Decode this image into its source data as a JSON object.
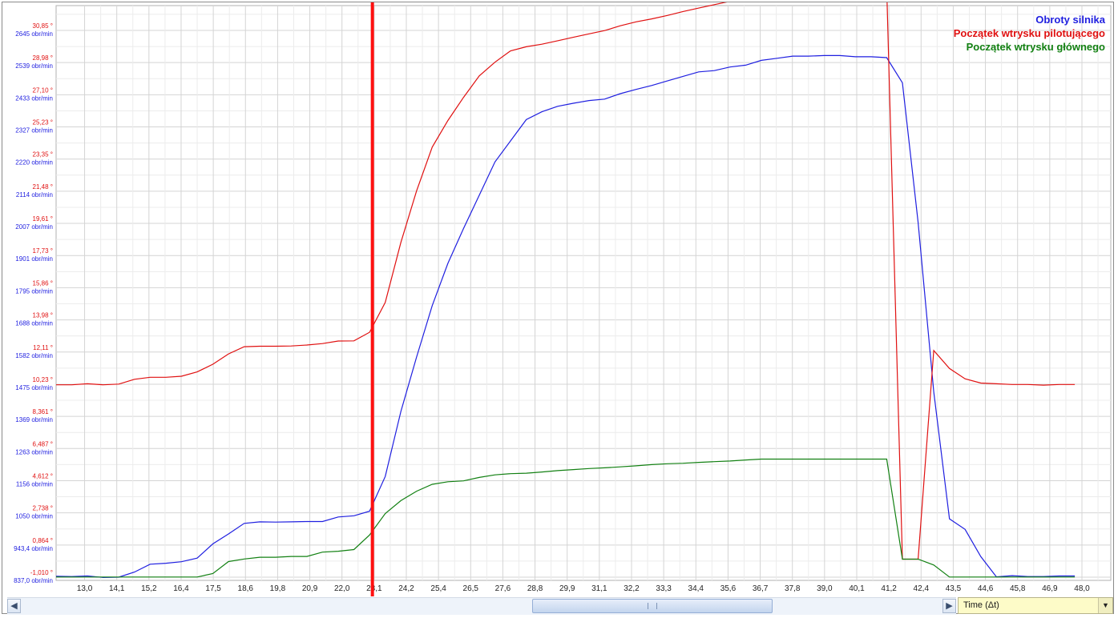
{
  "chart_data": {
    "type": "line",
    "title": "",
    "xlabel": "Time (Δt)",
    "x_ticks": [
      "13,0",
      "14,1",
      "15,2",
      "16,4",
      "17,5",
      "18,6",
      "19,8",
      "20,9",
      "22,0",
      "23,1",
      "24,2",
      "25,4",
      "26,5",
      "27,6",
      "28,8",
      "29,9",
      "31,1",
      "32,2",
      "33,3",
      "34,4",
      "35,6",
      "36,7",
      "37,8",
      "39,0",
      "40,1",
      "41,2",
      "42,4",
      "43,5",
      "44,6",
      "45,8",
      "46,9",
      "48,0"
    ],
    "x_range": [
      12.0,
      48.0
    ],
    "y_axis_rpm": {
      "unit": "obr/min",
      "ticks": [
        "837,0 obr/min",
        "943,4 obr/min",
        "1050 obr/min",
        "1156 obr/min",
        "1263 obr/min",
        "1369 obr/min",
        "1475 obr/min",
        "1582 obr/min",
        "1688 obr/min",
        "1795 obr/min",
        "1901 obr/min",
        "2007 obr/min",
        "2114 obr/min",
        "2220 obr/min",
        "2327 obr/min",
        "2433 obr/min",
        "2539 obr/min",
        "2645 obr/min"
      ],
      "range": [
        837.0,
        2645.0
      ],
      "color": "#1f1fe0"
    },
    "y_axis_angle": {
      "unit": "°",
      "ticks": [
        "-1,010 °",
        "0,864 °",
        "2,738 °",
        "4,612 °",
        "6,487 °",
        "8,361 °",
        "10,23 °",
        "12,11 °",
        "13,98 °",
        "15,86 °",
        "17,73 °",
        "19,61 °",
        "21,48 °",
        "23,35 °",
        "25,23 °",
        "27,10 °",
        "28,98 °",
        "30,85 °"
      ],
      "range": [
        -1.01,
        30.85
      ],
      "color": "#e01010"
    },
    "legend": {
      "position": "top-right"
    },
    "grid": true,
    "cursor_x": 23.1,
    "series": [
      {
        "name": "Obroty silnika",
        "axis": "rpm",
        "color": "#1f1fe0",
        "x": [
          12.0,
          12.55,
          13.1,
          13.65,
          14.2,
          14.75,
          15.3,
          15.85,
          16.4,
          16.95,
          17.5,
          18.05,
          18.6,
          19.15,
          19.7,
          20.25,
          20.8,
          21.35,
          21.9,
          22.45,
          23.0,
          23.55,
          24.1,
          24.65,
          25.2,
          25.75,
          26.3,
          26.85,
          27.4,
          27.95,
          28.5,
          29.05,
          29.6,
          30.15,
          30.7,
          31.25,
          31.8,
          32.35,
          32.9,
          33.45,
          34.0,
          34.55,
          35.1,
          35.65,
          36.2,
          36.75,
          37.3,
          37.85,
          38.4,
          38.95,
          39.5,
          40.05,
          40.6,
          41.15,
          41.7,
          42.25,
          42.8,
          43.35,
          43.9,
          44.45,
          45.0,
          45.55,
          46.1,
          46.65,
          47.2,
          47.75
        ],
        "y": [
          840,
          839,
          841,
          836,
          837,
          854,
          880,
          883,
          888,
          900,
          947,
          980,
          1015,
          1020,
          1019,
          1020,
          1021,
          1021,
          1036,
          1040,
          1055,
          1170,
          1385,
          1565,
          1735,
          1875,
          1990,
          2100,
          2210,
          2280,
          2350,
          2376,
          2394,
          2404,
          2413,
          2418,
          2436,
          2450,
          2463,
          2478,
          2493,
          2508,
          2512,
          2524,
          2530,
          2546,
          2553,
          2560,
          2560,
          2562,
          2562,
          2558,
          2558,
          2555,
          2472,
          2010,
          1450,
          1030,
          995,
          905,
          838,
          842,
          839,
          839,
          841,
          841
        ]
      },
      {
        "name": "Początek wtrysku pilotującego",
        "axis": "angle",
        "color": "#e01010",
        "x": [
          12.0,
          12.55,
          13.1,
          13.65,
          14.2,
          14.75,
          15.3,
          15.85,
          16.4,
          16.95,
          17.5,
          18.05,
          18.6,
          19.15,
          19.7,
          20.25,
          20.8,
          21.35,
          21.9,
          22.45,
          23.0,
          23.55,
          24.1,
          24.65,
          25.2,
          25.75,
          26.3,
          26.85,
          27.4,
          27.95,
          28.5,
          29.05,
          29.6,
          30.15,
          30.7,
          31.25,
          31.8,
          32.35,
          32.9,
          33.45,
          34.0,
          34.55,
          35.1,
          35.65,
          36.2,
          36.75,
          37.3,
          37.85,
          38.4,
          38.95,
          39.5,
          40.05,
          40.6,
          41.15,
          41.7,
          42.25,
          42.8,
          43.35,
          43.9,
          44.45,
          45.0,
          45.55,
          46.1,
          46.65,
          47.2,
          47.75
        ],
        "y": [
          10.2,
          10.2,
          10.26,
          10.2,
          10.24,
          10.52,
          10.64,
          10.64,
          10.7,
          10.95,
          11.4,
          12.0,
          12.42,
          12.45,
          12.45,
          12.46,
          12.52,
          12.6,
          12.75,
          12.76,
          13.26,
          15.0,
          18.5,
          21.5,
          24.05,
          25.6,
          26.95,
          28.2,
          29.0,
          29.66,
          29.9,
          30.05,
          30.25,
          30.45,
          30.65,
          30.84,
          31.12,
          31.35,
          31.52,
          31.72,
          31.95,
          32.15,
          32.35,
          32.55,
          32.6,
          32.75,
          32.9,
          32.98,
          33.05,
          33.1,
          33.2,
          33.15,
          33.2,
          33.3,
          0.04,
          0.04,
          12.2,
          11.15,
          10.55,
          10.3,
          10.26,
          10.22,
          10.22,
          10.18,
          10.22,
          10.22
        ]
      },
      {
        "name": "Początek wtrysku głównego",
        "axis": "angle",
        "color": "#128012",
        "x": [
          12.0,
          12.55,
          13.1,
          13.65,
          14.2,
          14.75,
          15.3,
          15.85,
          16.4,
          16.95,
          17.5,
          18.05,
          18.6,
          19.15,
          19.7,
          20.25,
          20.8,
          21.35,
          21.9,
          22.45,
          23.0,
          23.55,
          24.1,
          24.65,
          25.2,
          25.75,
          26.3,
          26.85,
          27.4,
          27.95,
          28.5,
          29.05,
          29.6,
          30.15,
          30.7,
          31.25,
          31.8,
          32.35,
          32.9,
          33.45,
          34.0,
          34.55,
          35.1,
          35.65,
          36.2,
          36.75,
          37.3,
          37.85,
          38.4,
          38.95,
          39.5,
          40.05,
          40.6,
          41.15,
          41.7,
          42.25,
          42.8,
          43.35,
          43.9,
          44.45,
          45.0,
          45.55,
          46.1,
          46.65,
          47.2,
          47.75
        ],
        "y": [
          -1.0,
          -1.0,
          -1.0,
          -1.0,
          -1.0,
          -1.0,
          -1.0,
          -1.0,
          -1.0,
          -1.0,
          -0.8,
          -0.1,
          0.05,
          0.15,
          0.15,
          0.2,
          0.2,
          0.45,
          0.5,
          0.6,
          1.45,
          2.7,
          3.45,
          4.0,
          4.4,
          4.55,
          4.6,
          4.8,
          4.95,
          5.02,
          5.05,
          5.12,
          5.2,
          5.26,
          5.32,
          5.36,
          5.42,
          5.48,
          5.55,
          5.6,
          5.63,
          5.68,
          5.72,
          5.76,
          5.82,
          5.87,
          5.87,
          5.87,
          5.87,
          5.87,
          5.87,
          5.87,
          5.87,
          5.87,
          0.04,
          0.04,
          -0.3,
          -1.0,
          -1.0,
          -1.0,
          -1.0,
          -1.0,
          -1.0,
          -1.0,
          -1.0,
          -1.0
        ]
      }
    ]
  }
}
